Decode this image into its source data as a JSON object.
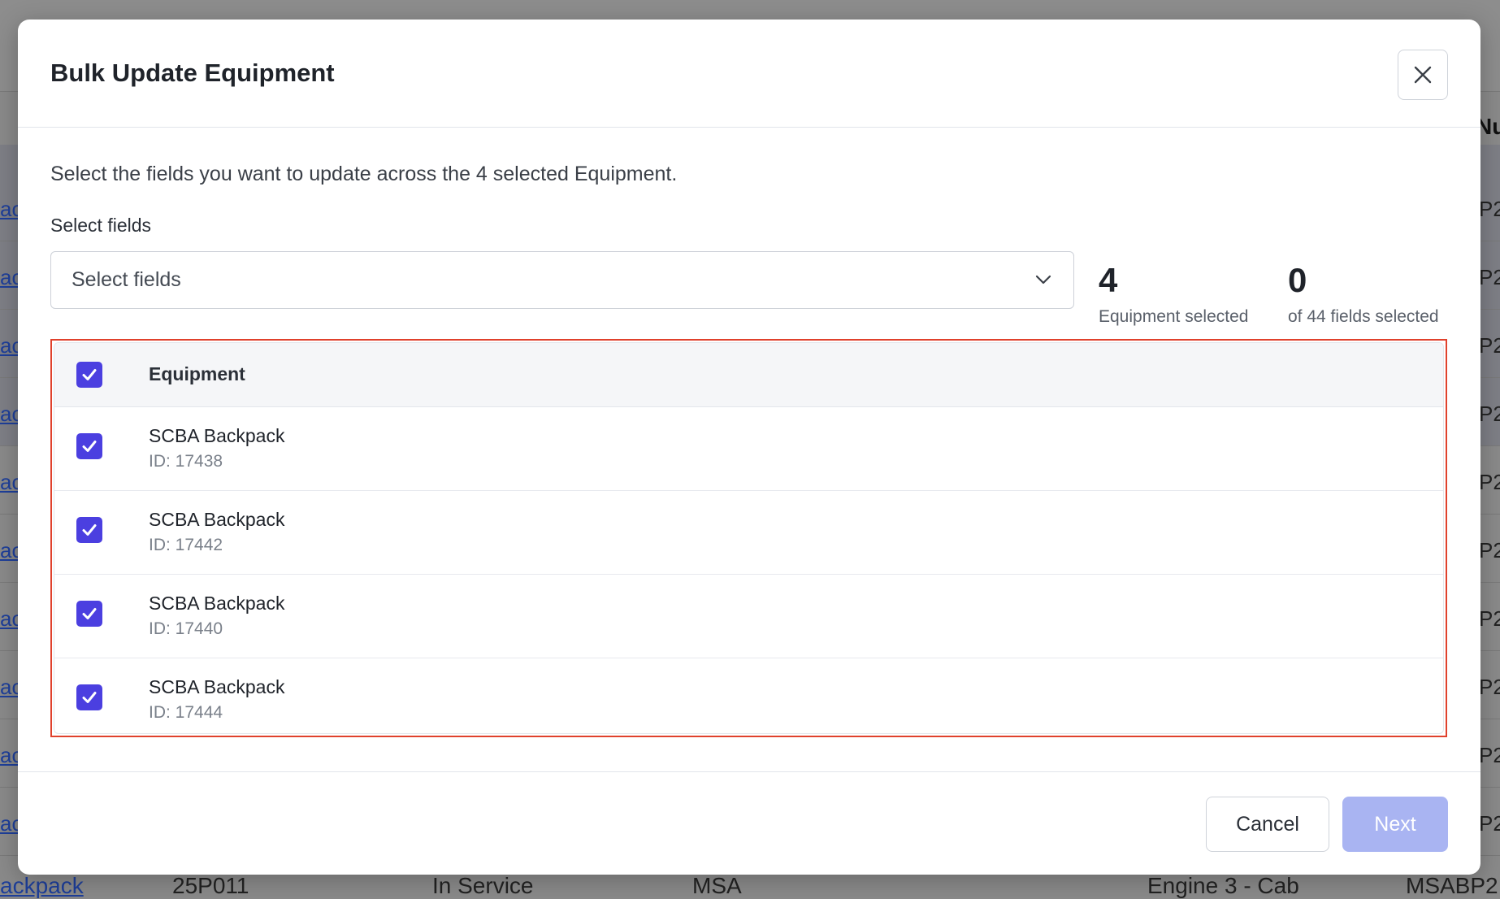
{
  "modal": {
    "title": "Bulk Update Equipment",
    "intro": "Select the fields you want to update across the 4 selected Equipment.",
    "field_label": "Select fields",
    "select_placeholder": "Select fields",
    "stats": {
      "equipment_count": "4",
      "equipment_caption": "Equipment selected",
      "fields_count": "0",
      "fields_caption": "of 44 fields selected"
    },
    "table": {
      "header": "Equipment",
      "header_checked": true,
      "rows": [
        {
          "name": "SCBA Backpack",
          "id": "ID: 17438",
          "checked": true
        },
        {
          "name": "SCBA Backpack",
          "id": "ID: 17442",
          "checked": true
        },
        {
          "name": "SCBA Backpack",
          "id": "ID: 17440",
          "checked": true
        },
        {
          "name": "SCBA Backpack",
          "id": "ID: 17444",
          "checked": true
        }
      ]
    },
    "buttons": {
      "cancel": "Cancel",
      "next": "Next"
    },
    "icons": {
      "close": "close-icon",
      "dropdown": "chevron-down-icon",
      "checkbox": "checkbox-checked-icon"
    },
    "colors": {
      "accent": "#4b3fe0",
      "next_disabled": "#a9b4f2",
      "highlight_border": "#e0412c"
    }
  },
  "background_table": {
    "header_partial": "Nu",
    "row_left_partial": "ac",
    "row_right_partial": "P2",
    "last_row": {
      "col1": "ackpack",
      "col2": "25P011",
      "col3": "In Service",
      "col4": "MSA",
      "col5": "Engine 3 - Cab",
      "col6": "MSABP2"
    }
  }
}
